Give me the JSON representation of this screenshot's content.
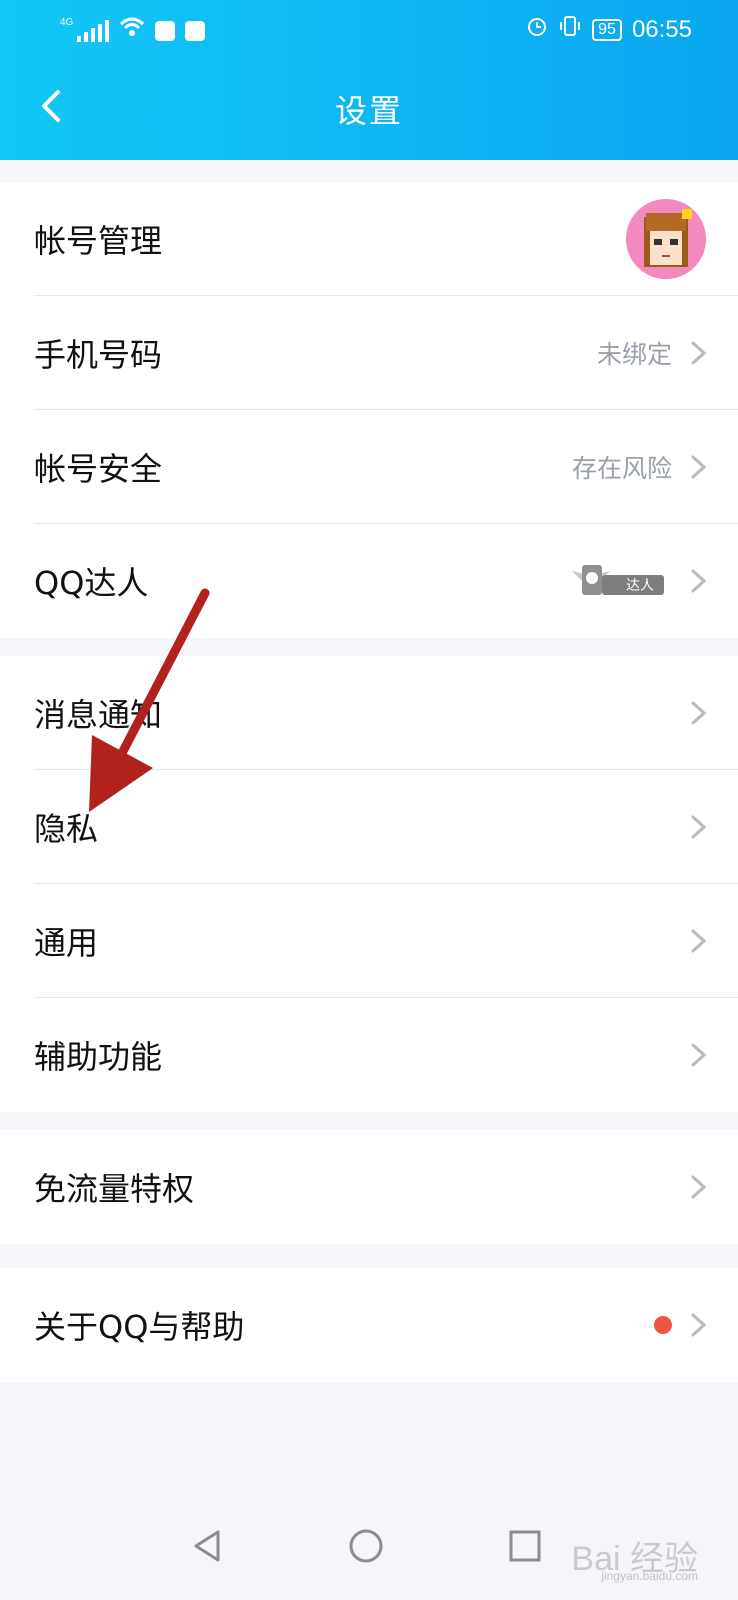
{
  "status_bar": {
    "signal_label": "4G",
    "battery_level": "95",
    "time": "06:55",
    "icons": [
      "signal-icon",
      "wifi-icon",
      "shield-icon",
      "baidu-paw-icon",
      "alarm-icon",
      "vibrate-icon",
      "battery-icon"
    ]
  },
  "header": {
    "title": "设置",
    "back_icon": "back-arrow-icon"
  },
  "sections": {
    "account": {
      "items": [
        {
          "label": "帐号管理"
        },
        {
          "label": "手机号码",
          "value": "未绑定"
        },
        {
          "label": "帐号安全",
          "value": "存在风险"
        },
        {
          "label": "QQ达人",
          "badge_text": "达人"
        }
      ]
    },
    "general": {
      "items": [
        {
          "label": "消息通知"
        },
        {
          "label": "隐私"
        },
        {
          "label": "通用"
        },
        {
          "label": "辅助功能"
        }
      ]
    },
    "traffic": {
      "items": [
        {
          "label": "免流量特权"
        }
      ]
    },
    "about": {
      "items": [
        {
          "label": "关于QQ与帮助"
        }
      ]
    }
  },
  "nav_bar": {
    "icons": [
      "back-triangle-icon",
      "home-circle-icon",
      "recent-square-icon"
    ]
  },
  "watermark": {
    "brand": "Bai 经验",
    "url": "jingyan.baidu.com"
  },
  "colors": {
    "header_start": "#13c8f5",
    "header_end": "#0aa6f0",
    "red_dot": "#f25444",
    "annotation_arrow": "#b2221c"
  }
}
